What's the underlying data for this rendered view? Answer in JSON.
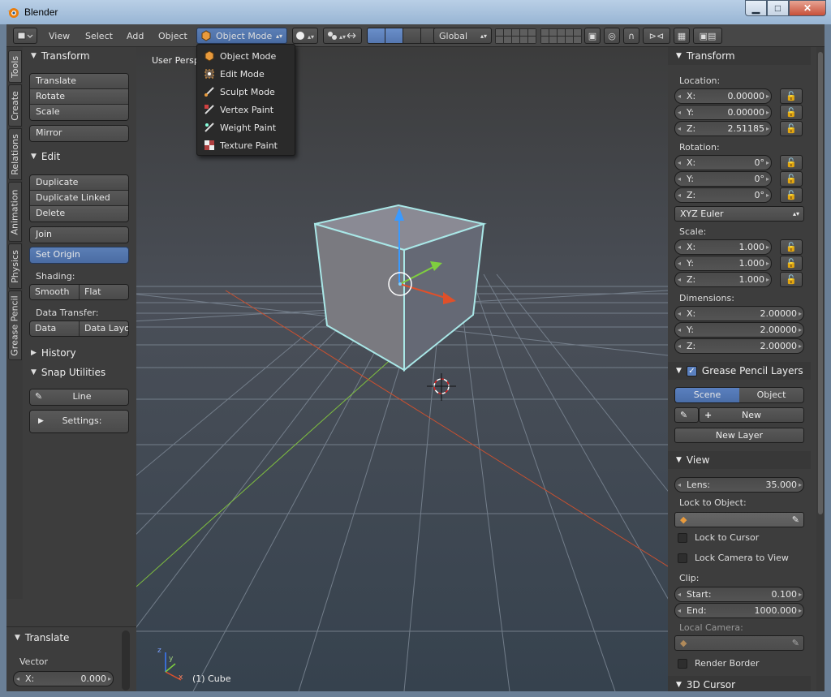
{
  "window": {
    "title": "Blender"
  },
  "header": {
    "menus": [
      "View",
      "Select",
      "Add",
      "Object"
    ],
    "mode": "Object Mode",
    "orientation": "Global"
  },
  "mode_menu": {
    "items": [
      "Object Mode",
      "Edit Mode",
      "Sculpt Mode",
      "Vertex Paint",
      "Weight Paint",
      "Texture Paint"
    ]
  },
  "tabs": [
    "Tools",
    "Create",
    "Relations",
    "Animation",
    "Physics",
    "Grease Pencil"
  ],
  "tools": {
    "transform_title": "Transform",
    "translate": "Translate",
    "rotate": "Rotate",
    "scale": "Scale",
    "mirror": "Mirror",
    "edit_title": "Edit",
    "duplicate": "Duplicate",
    "duplicate_linked": "Duplicate Linked",
    "delete": "Delete",
    "join": "Join",
    "set_origin": "Set Origin",
    "shading_label": "Shading:",
    "smooth": "Smooth",
    "flat": "Flat",
    "data_transfer_label": "Data Transfer:",
    "data": "Data",
    "data_layout": "Data Layo",
    "history_title": "History",
    "snap_title": "Snap Utilities",
    "line": "Line",
    "settings": "Settings:"
  },
  "operator": {
    "title": "Translate",
    "vector_label": "Vector",
    "x_label": "X:",
    "x_value": "0.000"
  },
  "viewport": {
    "label": "User Persp",
    "object": "(1) Cube"
  },
  "properties": {
    "transform_title": "Transform",
    "location_label": "Location:",
    "location": [
      {
        "axis": "X:",
        "value": "0.00000"
      },
      {
        "axis": "Y:",
        "value": "0.00000"
      },
      {
        "axis": "Z:",
        "value": "2.51185"
      }
    ],
    "rotation_label": "Rotation:",
    "rotation": [
      {
        "axis": "X:",
        "value": "0°"
      },
      {
        "axis": "Y:",
        "value": "0°"
      },
      {
        "axis": "Z:",
        "value": "0°"
      }
    ],
    "rotation_mode": "XYZ Euler",
    "scale_label": "Scale:",
    "scale": [
      {
        "axis": "X:",
        "value": "1.000"
      },
      {
        "axis": "Y:",
        "value": "1.000"
      },
      {
        "axis": "Z:",
        "value": "1.000"
      }
    ],
    "dimensions_label": "Dimensions:",
    "dimensions": [
      {
        "axis": "X:",
        "value": "2.00000"
      },
      {
        "axis": "Y:",
        "value": "2.00000"
      },
      {
        "axis": "Z:",
        "value": "2.00000"
      }
    ],
    "gp_layers_title": "Grease Pencil Layers",
    "gp_scene": "Scene",
    "gp_object": "Object",
    "gp_new": "New",
    "gp_new_layer": "New Layer",
    "view_title": "View",
    "lens_label": "Lens:",
    "lens_value": "35.000",
    "lock_to_object_label": "Lock to Object:",
    "lock_to_cursor": "Lock to Cursor",
    "lock_camera_to_view": "Lock Camera to View",
    "clip_label": "Clip:",
    "clip_start_label": "Start:",
    "clip_start_value": "0.100",
    "clip_end_label": "End:",
    "clip_end_value": "1000.000",
    "local_camera_label": "Local Camera:",
    "render_border": "Render Border",
    "cursor_title": "3D Cursor"
  }
}
